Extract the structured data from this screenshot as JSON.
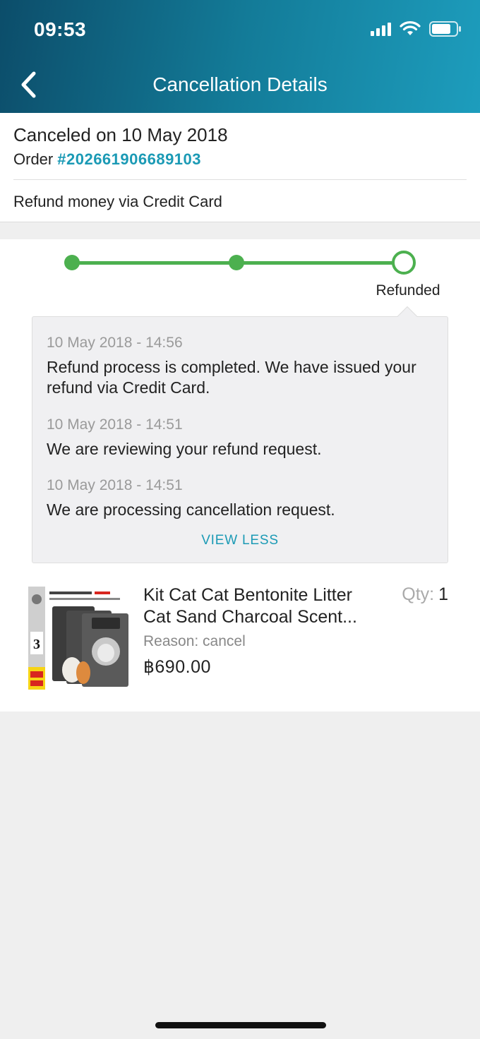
{
  "status_bar": {
    "time": "09:53"
  },
  "header": {
    "title": "Cancellation Details"
  },
  "summary": {
    "canceled_on": "Canceled on 10 May 2018",
    "order_label": "Order",
    "order_number": "#202661906689103",
    "refund_method": "Refund money via Credit Card"
  },
  "progress": {
    "steps_total": 3,
    "current_step": 3,
    "current_label": "Refunded",
    "accent_color": "#4cb04f"
  },
  "timeline": {
    "entries": [
      {
        "date": "10 May 2018 - 14:56",
        "text": "Refund process is completed. We have issued your refund via Credit Card."
      },
      {
        "date": "10 May 2018 - 14:51",
        "text": "We are reviewing your refund request."
      },
      {
        "date": "10 May 2018 - 14:51",
        "text": "We are processing cancellation request."
      }
    ],
    "toggle_label": "VIEW LESS"
  },
  "product": {
    "name": "Kit Cat Cat Bentonite Litter Cat Sand Charcoal Scent...",
    "qty_label": "Qty:",
    "qty": "1",
    "reason": "Reason: cancel",
    "price": "฿690.00",
    "image_icon": "product-thumbnail"
  },
  "colors": {
    "header_start": "#0c4d6a",
    "header_end": "#1d9dbd",
    "link": "#1b9ab5"
  }
}
